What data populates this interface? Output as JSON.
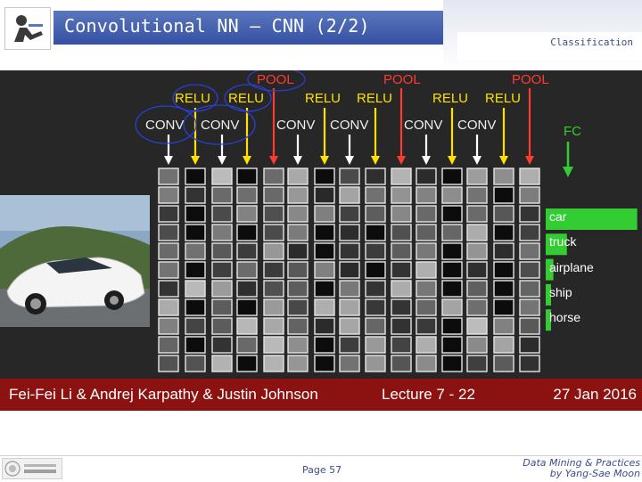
{
  "header": {
    "title": "Convolutional NN – CNN (2/2)",
    "section": "Classification"
  },
  "figure": {
    "pool_labels": [
      "POOL",
      "POOL",
      "POOL"
    ],
    "relu_labels": [
      "RELU",
      "RELU",
      "RELU",
      "RELU",
      "RELU",
      "RELU"
    ],
    "conv_labels": [
      "CONV",
      "CONV",
      "CONV",
      "CONV",
      "CONV",
      "CONV"
    ],
    "fc_label": "FC",
    "classes": [
      "car",
      "truck",
      "airplane",
      "ship",
      "horse"
    ],
    "class_scores": [
      0.95,
      0.22,
      0.08,
      0.05,
      0.03
    ],
    "credit": {
      "authors": "Fei-Fei Li & Andrej Karpathy & Justin Johnson",
      "lecture": "Lecture 7 - 22",
      "date": "27 Jan 2016"
    },
    "colors": {
      "background": "#272727",
      "relu": "#ffe000",
      "pool": "#ff3b2f",
      "fc": "#33cc33",
      "highlight_circle": "#2a3fd6",
      "credit_bar": "#8c1212"
    }
  },
  "footer": {
    "page": "Page 57",
    "course_line1": "Data Mining & Practices",
    "course_line2": "by Yang-Sae Moon"
  }
}
